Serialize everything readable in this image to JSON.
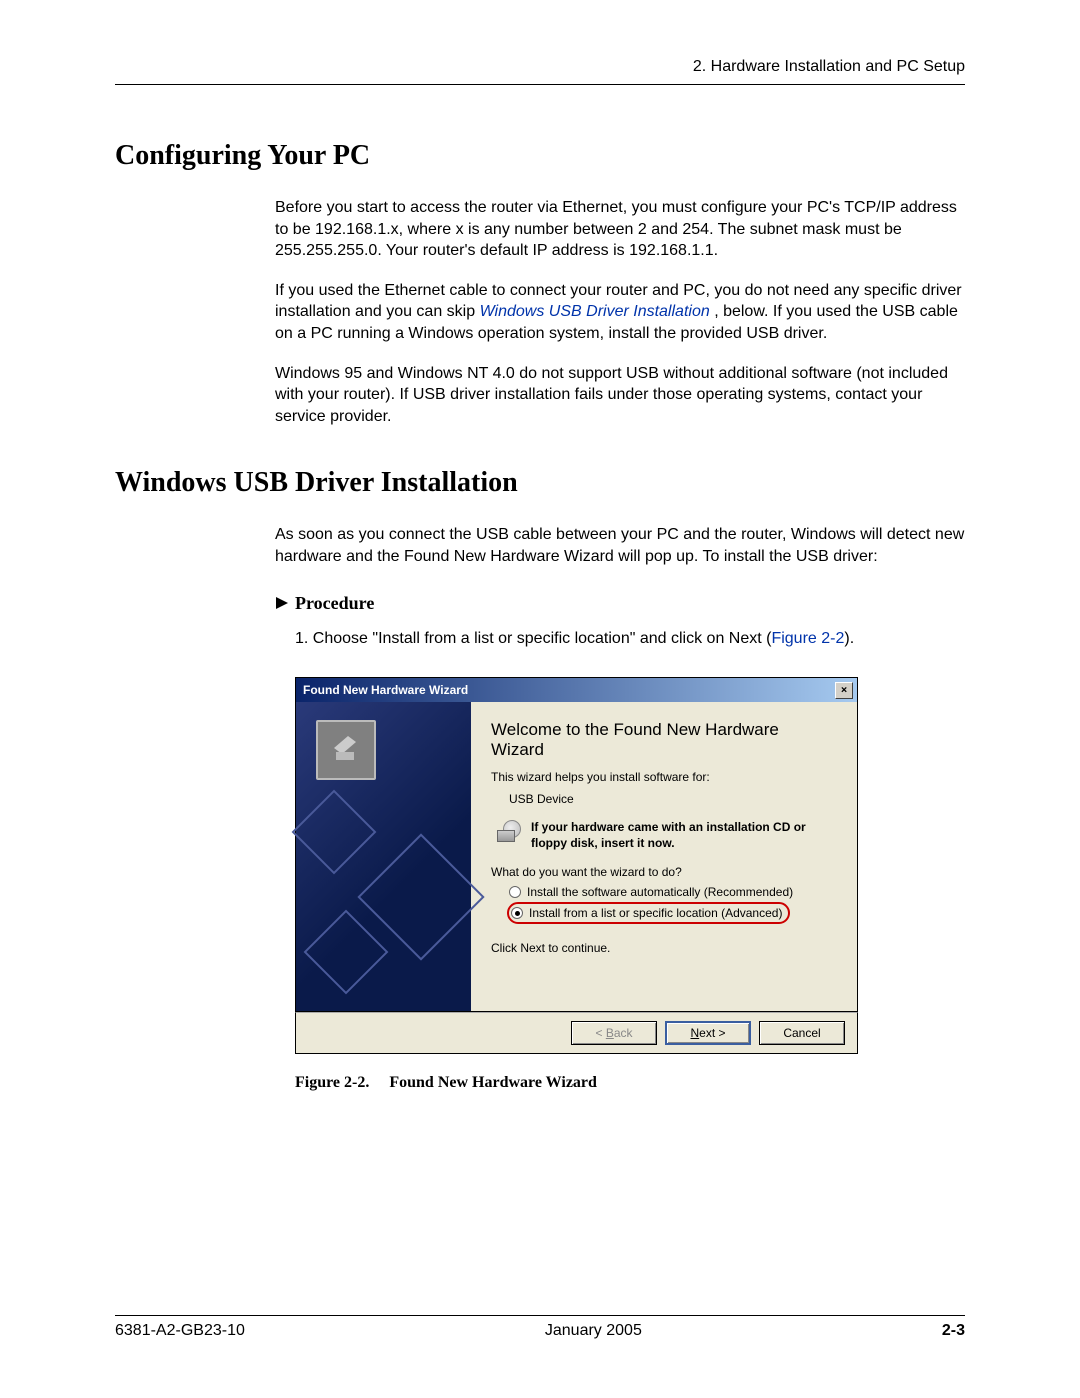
{
  "header": {
    "chapter": "2. Hardware Installation and PC Setup"
  },
  "section1": {
    "title": "Configuring Your PC",
    "p1": "Before you start to access the router via Ethernet, you must configure your PC's TCP/IP address to be 192.168.1.x, where x is any number between 2 and 254. The subnet mask must be 255.255.255.0. Your router's default IP address is 192.168.1.1.",
    "p2_pre": "If you used the Ethernet cable to connect your router and PC, you do not need any specific driver installation and you can skip ",
    "p2_link": "Windows USB Driver Installation",
    "p2_post": ", below. If you used the USB cable on a PC running a Windows operation system, install the provided USB driver.",
    "p3": "Windows 95 and Windows NT 4.0 do not support USB without additional software (not included with your router). If USB driver installation fails under those operating systems, contact your service provider."
  },
  "section2": {
    "title": "Windows USB Driver Installation",
    "p1": "As soon as you connect the USB cable between your PC and the router, Windows will detect new hardware and the Found New Hardware Wizard will pop up. To install the USB driver:",
    "procedure_label": "Procedure",
    "step1_num": "1.",
    "step1_text": "Choose \"Install from a list or specific location\" and click on Next (",
    "step1_ref": "Figure 2-2",
    "step1_end": ")."
  },
  "wizard": {
    "title": "Found New Hardware Wizard",
    "heading": "Welcome to the Found New Hardware Wizard",
    "helps": "This wizard helps you install software for:",
    "device": "USB Device",
    "cd_text": "If your hardware came with an installation CD or floppy disk, insert it now.",
    "prompt": "What do you want the wizard to do?",
    "opt1": "Install the software automatically (Recommended)",
    "opt2": "Install from a list or specific location (Advanced)",
    "click_next": "Click Next to continue.",
    "btn_back_pre": "< ",
    "btn_back_u": "B",
    "btn_back_post": "ack",
    "btn_next_u": "N",
    "btn_next_post": "ext >",
    "btn_cancel": "Cancel"
  },
  "figure": {
    "label_num": "Figure 2-2.",
    "label_title": "Found New Hardware Wizard"
  },
  "footer": {
    "doc": "6381-A2-GB23-10",
    "date": "January 2005",
    "page": "2-3"
  }
}
